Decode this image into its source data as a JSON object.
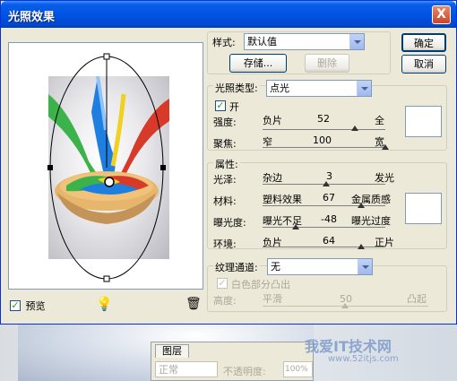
{
  "window": {
    "title": "光照效果",
    "close_label": "X"
  },
  "preview": {
    "checkbox_label": "预览",
    "checked": true
  },
  "style": {
    "label": "样式:",
    "value": "默认值",
    "save_label": "存储...",
    "delete_label": "删除"
  },
  "buttons": {
    "ok": "确定",
    "cancel": "取消"
  },
  "light_type": {
    "label": "光照类型:",
    "value": "点光",
    "on_label": "开",
    "on_checked": true
  },
  "intensity": {
    "label": "强度:",
    "left": "负片",
    "value": "52",
    "right": "全",
    "level": 0.76
  },
  "focus": {
    "label": "聚焦:",
    "left": "窄",
    "value": "100",
    "right": "宽",
    "level": 1.0
  },
  "properties": {
    "title": "属性:"
  },
  "gloss": {
    "label": "光泽:",
    "left": "杂边",
    "value": "3",
    "right": "发光",
    "level": 0.52
  },
  "material": {
    "label": "材料:",
    "left": "塑料效果",
    "value": "67",
    "right": "金属质感",
    "level": 0.82
  },
  "exposure": {
    "label": "曝光度:",
    "left": "曝光不足",
    "value": "-48",
    "right": "曝光过度",
    "level": 0.24
  },
  "ambience": {
    "label": "环境:",
    "left": "负片",
    "value": "64",
    "right": "正片",
    "level": 0.82
  },
  "texture": {
    "label": "纹理通道:",
    "value": "无",
    "white_high_label": "白色部分凸出",
    "height_label": "高度:",
    "left": "平滑",
    "value_num": "50",
    "right": "凸起",
    "level": 0.5
  },
  "background": {
    "layers_tab": "图层",
    "blend_mode": "正常",
    "opacity_label": "不透明度:",
    "opacity_value": "100%",
    "watermark": "我爱IT技术网",
    "watermark_url": "www.52itjs.com"
  },
  "colors": {
    "title_bar": "#0054e3",
    "dialog_bg": "#ece9d8",
    "accent_red": "#d83a2a",
    "accent_blue": "#1f7fe0",
    "accent_green": "#3bb34a"
  }
}
